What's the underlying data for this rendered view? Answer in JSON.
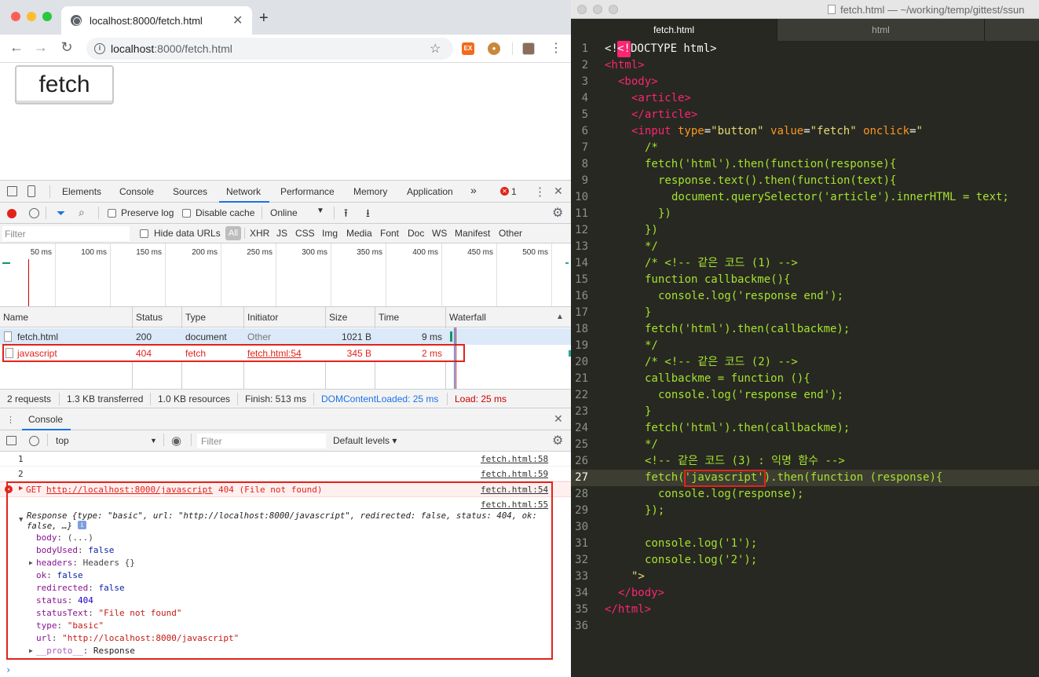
{
  "chrome": {
    "tab_title": "localhost:8000/fetch.html",
    "url_host": "localhost",
    "url_rest": ":8000/fetch.html"
  },
  "page": {
    "fetch_button": "fetch"
  },
  "devtools": {
    "tabs": [
      "Elements",
      "Console",
      "Sources",
      "Network",
      "Performance",
      "Memory",
      "Application"
    ],
    "more": "»",
    "error_count": "1",
    "network_toolbar": {
      "preserve_log": "Preserve log",
      "disable_cache": "Disable cache",
      "throttle": "Online"
    },
    "filter_bar": {
      "placeholder": "Filter",
      "hide_data_urls": "Hide data URLs",
      "types": [
        "All",
        "XHR",
        "JS",
        "CSS",
        "Img",
        "Media",
        "Font",
        "Doc",
        "WS",
        "Manifest",
        "Other"
      ]
    },
    "timeline_ticks": [
      "50 ms",
      "100 ms",
      "150 ms",
      "200 ms",
      "250 ms",
      "300 ms",
      "350 ms",
      "400 ms",
      "450 ms",
      "500 ms"
    ],
    "columns": [
      "Name",
      "Status",
      "Type",
      "Initiator",
      "Size",
      "Time",
      "Waterfall"
    ],
    "requests": [
      {
        "name": "fetch.html",
        "status": "200",
        "type": "document",
        "initiator": "Other",
        "size": "1021 B",
        "time": "9 ms"
      },
      {
        "name": "javascript",
        "status": "404",
        "type": "fetch",
        "initiator": "fetch.html:54",
        "size": "345 B",
        "time": "2 ms"
      }
    ],
    "status_bar": {
      "requests": "2 requests",
      "transferred": "1.3 KB transferred",
      "resources": "1.0 KB resources",
      "finish": "Finish: 513 ms",
      "dcl": "DOMContentLoaded: 25 ms",
      "load": "Load: 25 ms"
    },
    "console": {
      "drawer_tab": "Console",
      "context": "top",
      "filter_placeholder": "Filter",
      "levels": "Default levels ▾",
      "log": [
        {
          "text": "1",
          "src": "fetch.html:58"
        },
        {
          "text": "2",
          "src": "fetch.html:59"
        }
      ],
      "error": {
        "method": "GET",
        "url": "http://localhost:8000/javascript",
        "rest": "404 (File not found)",
        "src": "fetch.html:54"
      },
      "response_src": "fetch.html:55",
      "response_summary_1": "Response {type: \"basic\", url: \"http://localhost:8000/javascript\", redirected: false, status: 404, ok:",
      "response_summary_2": "false, …}",
      "props": [
        {
          "key": "body",
          "val": "(...)"
        },
        {
          "key": "bodyUsed",
          "val": "false"
        },
        {
          "key": "headers",
          "val": "Headers {}"
        },
        {
          "key": "ok",
          "val": "false"
        },
        {
          "key": "redirected",
          "val": "false"
        },
        {
          "key": "status",
          "val": "404"
        },
        {
          "key": "statusText",
          "val": "\"File not found\""
        },
        {
          "key": "type",
          "val": "\"basic\""
        },
        {
          "key": "url",
          "val": "\"http://localhost:8000/javascript\""
        },
        {
          "key": "__proto__",
          "val": "Response"
        }
      ]
    }
  },
  "editor": {
    "window_title": "fetch.html — ~/working/temp/gittest/ssun",
    "tabs": [
      "fetch.html",
      "html"
    ],
    "line_numbers": [
      "1",
      "2",
      "3",
      "4",
      "5",
      "6",
      "7",
      "8",
      "9",
      "10",
      "11",
      "12",
      "13",
      "14",
      "15",
      "16",
      "17",
      "18",
      "19",
      "20",
      "21",
      "22",
      "23",
      "24",
      "25",
      "26",
      "27",
      "28",
      "29",
      "30",
      "31",
      "32",
      "33",
      "34",
      "35",
      "36"
    ],
    "code": {
      "l1a": "<!",
      "l1b": "<!",
      "l1c": "DOCTYPE html>",
      "l2": "<html>",
      "l3": "<body>",
      "l4": "<article>",
      "l5": "</article>",
      "l6_tag": "<input",
      "l6_a1": " type",
      "l6_v1": "\"button\"",
      "l6_a2": " value",
      "l6_v2": "\"fetch\"",
      "l6_a3": " onclick",
      "l6_v3": "\"",
      "l7": "/*",
      "l8": "fetch('html').then(function(response){",
      "l9": "response.text().then(function(text){",
      "l10": "document.querySelector('article').innerHTML = text;",
      "l11": "})",
      "l12": "})",
      "l13": "*/",
      "l14": "/* <!-- 같은 코드 (1) -->",
      "l15": "function callbackme(){",
      "l16": "console.log('response end');",
      "l17": "}",
      "l18": "fetch('html').then(callbackme);",
      "l19": "*/",
      "l20": "/* <!-- 같은 코드 (2) -->",
      "l21": "callbackme = function (){",
      "l22": "console.log('response end');",
      "l23": "}",
      "l24": "fetch('html').then(callbackme);",
      "l25": "*/",
      "l26": "<!-- 같은 코드 (3) : 익명 함수 -->",
      "l27a": "fetch(",
      "l27b": "'javascript'",
      "l27c": ").then(function (response){",
      "l28": "console.log(response);",
      "l29": "});",
      "l31": "console.log('1');",
      "l32": "console.log('2');",
      "l33": "\">",
      "l34": "</body>",
      "l35": "</html>"
    }
  },
  "colors": {
    "error_red": "#e2231a",
    "devtools_blue": "#1a73e8",
    "editor_bg": "#272822",
    "editor_green": "#a6e22e",
    "editor_pink": "#f92672",
    "editor_yellow": "#e6db74"
  }
}
